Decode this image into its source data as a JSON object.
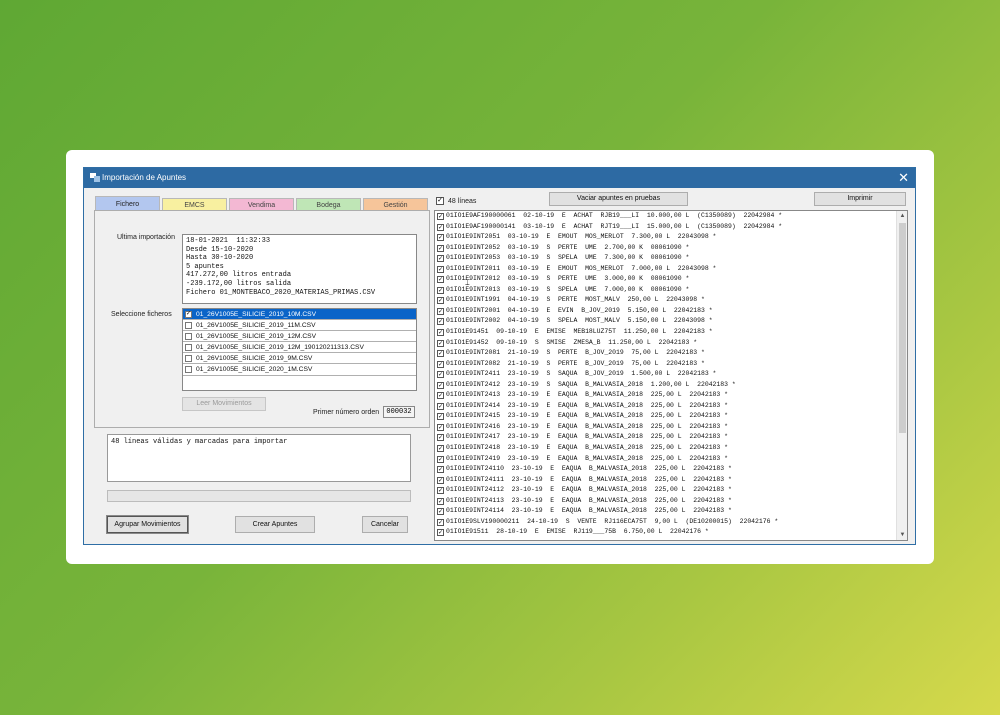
{
  "window": {
    "title": "Importación de Apuntes",
    "close_glyph": "✕"
  },
  "tabs": [
    {
      "label": "Fichero",
      "color": "#b3c7ef",
      "active": true
    },
    {
      "label": "EMCS",
      "color": "#f8f0a0"
    },
    {
      "label": "Vendima",
      "color": "#f3b8d3"
    },
    {
      "label": "Bodega",
      "color": "#bfe6b6"
    },
    {
      "label": "Gestión",
      "color": "#f6c59a"
    }
  ],
  "import_panel": {
    "last_import_label": "Ultima importación",
    "last_import_text": "18-01-2021  11:32:33\nDesde 15-10-2020\nHasta 30-10-2020\n5 apuntes\n417.272,00 litros entrada\n-239.172,00 litros salida\nFichero 01_MONTEBACO_2020_MATERIAS_PRIMAS.CSV",
    "select_files_label": "Seleccione ficheros",
    "files": [
      {
        "name": "01_26V1005E_SILICIE_2019_10M.CSV",
        "checked": true,
        "selected": true
      },
      {
        "name": "01_26V1005E_SILICIE_2019_11M.CSV",
        "checked": false
      },
      {
        "name": "01_26V1005E_SILICIE_2019_12M.CSV",
        "checked": false
      },
      {
        "name": "01_26V1005E_SILICIE_2019_12M_190120211313.CSV",
        "checked": false
      },
      {
        "name": "01_26V1005E_SILICIE_2019_9M.CSV",
        "checked": false
      },
      {
        "name": "01_26V1005E_SILICIE_2020_1M.CSV",
        "checked": false
      }
    ],
    "read_button": "Leer Movimientos",
    "first_number_label": "Primer número orden",
    "first_number_value": "000032"
  },
  "status_text": "48 líneas válidas y marcadas para importar",
  "progress": 0,
  "bottom_buttons": {
    "group": "Agrupar Movimientos",
    "create": "Crear Apuntes",
    "cancel": "Cancelar"
  },
  "right_panel": {
    "count_label": "48 líneas",
    "clear_button": "Vaciar apuntes en pruebas",
    "print_button": "Imprimir",
    "rows": [
      "01IO1E9AF190000061  02-10-19  E  ACHAT  RJB19___LI  10.000,00 L  (C1350089)  22042984 *",
      "01IO1E9AF190000141  03-10-19  E  ACHAT  RJT19___LI  15.000,00 L  (C1350089)  22042984 *",
      "01IO1E9INT2051  03-10-19  E  EMOUT  MOS_MERLOT  7.300,00 L  22043098 *",
      "01IO1E9INT2052  03-10-19  S  PERTE  UME  2.700,00 K  08061090 *",
      "01IO1E9INT2053  03-10-19  S  SPELA  UME  7.300,00 K  08061090 *",
      "01IO1E9INT2011  03-10-19  E  EMOUT  MOS_MERLOT  7.000,00 L  22043098 *",
      "01IO1E9INT2012  03-10-19  S  PERTE  UME  3.000,00 K  08061090 *",
      "01IO1E9INT2013  03-10-19  S  SPELA  UME  7.000,00 K  08061090 *",
      "01IO1E9INT1991  04-10-19  S  PERTE  MOST_MALV  250,00 L  22043098 *",
      "01IO1E9INT2001  04-10-19  E  EVIN  B_JOV_2019  5.150,00 L  22042183 *",
      "01IO1E9INT2002  04-10-19  S  SPELA  MOST_MALV  5.150,00 L  22043098 *",
      "01IO1E91451  09-10-19  E  EMISE  MEB18LUZ75T  11.250,00 L  22042183 *",
      "01IO1E91452  09-10-19  S  SMISE  ZMESA_B  11.250,00 L  22042183 *",
      "01IO1E9INT2081  21-10-19  S  PERTE  B_JOV_2019  75,00 L  22042183 *",
      "01IO1E9INT2082  21-10-19  S  PERTE  B_JOV_2019  75,00 L  22042183 *",
      "01IO1E9INT2411  23-10-19  S  SAQUA  B_JOV_2019  1.500,00 L  22042183 *",
      "01IO1E9INT2412  23-10-19  S  SAQUA  B_MALVASIA_2018  1.200,00 L  22042183 *",
      "01IO1E9INT2413  23-10-19  E  EAQUA  B_MALVASIA_2018  225,00 L  22042183 *",
      "01IO1E9INT2414  23-10-19  E  EAQUA  B_MALVASIA_2018  225,00 L  22042183 *",
      "01IO1E9INT2415  23-10-19  E  EAQUA  B_MALVASIA_2018  225,00 L  22042183 *",
      "01IO1E9INT2416  23-10-19  E  EAQUA  B_MALVASIA_2018  225,00 L  22042183 *",
      "01IO1E9INT2417  23-10-19  E  EAQUA  B_MALVASIA_2018  225,00 L  22042183 *",
      "01IO1E9INT2418  23-10-19  E  EAQUA  B_MALVASIA_2018  225,00 L  22042183 *",
      "01IO1E9INT2419  23-10-19  E  EAQUA  B_MALVASIA_2018  225,00 L  22042183 *",
      "01IO1E9INT24110  23-10-19  E  EAQUA  B_MALVASIA_2018  225,00 L  22042183 *",
      "01IO1E9INT24111  23-10-19  E  EAQUA  B_MALVASIA_2018  225,00 L  22042183 *",
      "01IO1E9INT24112  23-10-19  E  EAQUA  B_MALVASIA_2018  225,00 L  22042183 *",
      "01IO1E9INT24113  23-10-19  E  EAQUA  B_MALVASIA_2018  225,00 L  22042183 *",
      "01IO1E9INT24114  23-10-19  E  EAQUA  B_MALVASIA_2018  225,00 L  22042183 *",
      "01IO1E9SLV190000211  24-10-19  S  VENTE  RJ116ECA75T  9,00 L  (DE10200015)  22042176 *",
      "01IO1E91511  28-10-19  E  EMISE  RJ119___75B  6.750,00 L  22042176 *"
    ]
  }
}
